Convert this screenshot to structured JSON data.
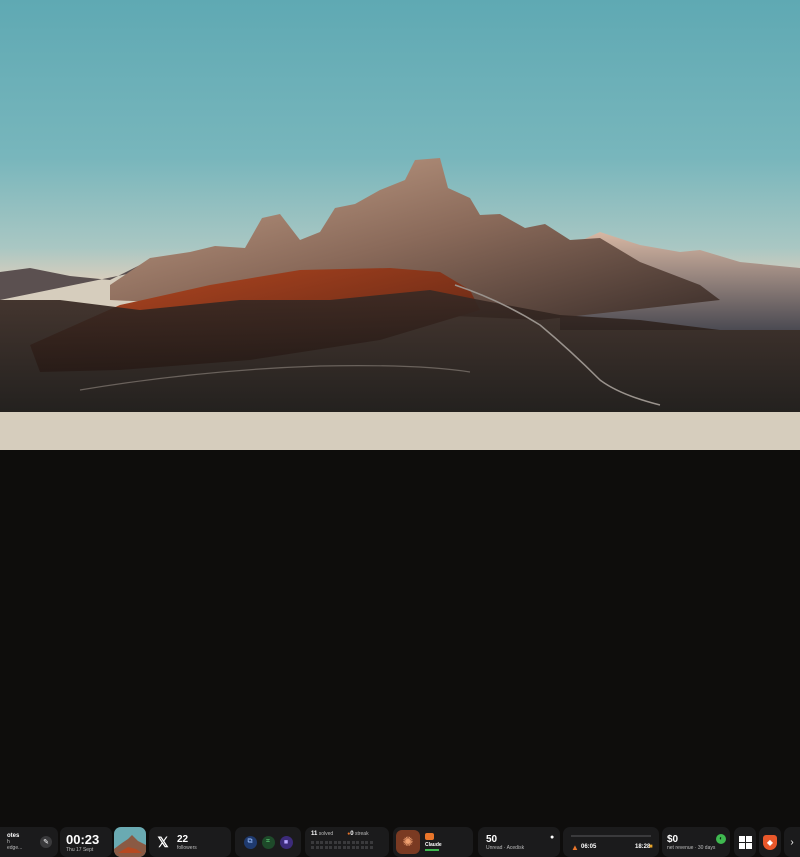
{
  "notes": {
    "title": "otes",
    "line1": "h",
    "line2": "edge..."
  },
  "clock": {
    "time": "00:23",
    "date": "Thu 17 Sept"
  },
  "x_widget": {
    "count": "22",
    "label": "followers"
  },
  "solved": {
    "count": "11",
    "count_label": "solved",
    "streak": "0",
    "streak_label": "streak"
  },
  "app_widget": {
    "label": "Claude"
  },
  "unread": {
    "count": "50",
    "label": "Unread · Acedisk"
  },
  "media": {
    "time_left": "06:05",
    "time_right": "18:28"
  },
  "revenue": {
    "amount": "$0",
    "label": "net revenue · 30 days"
  },
  "colors": {
    "accent_green": "#3fb950",
    "accent_orange": "#e8752a",
    "accent_purple": "#7a5cff"
  }
}
